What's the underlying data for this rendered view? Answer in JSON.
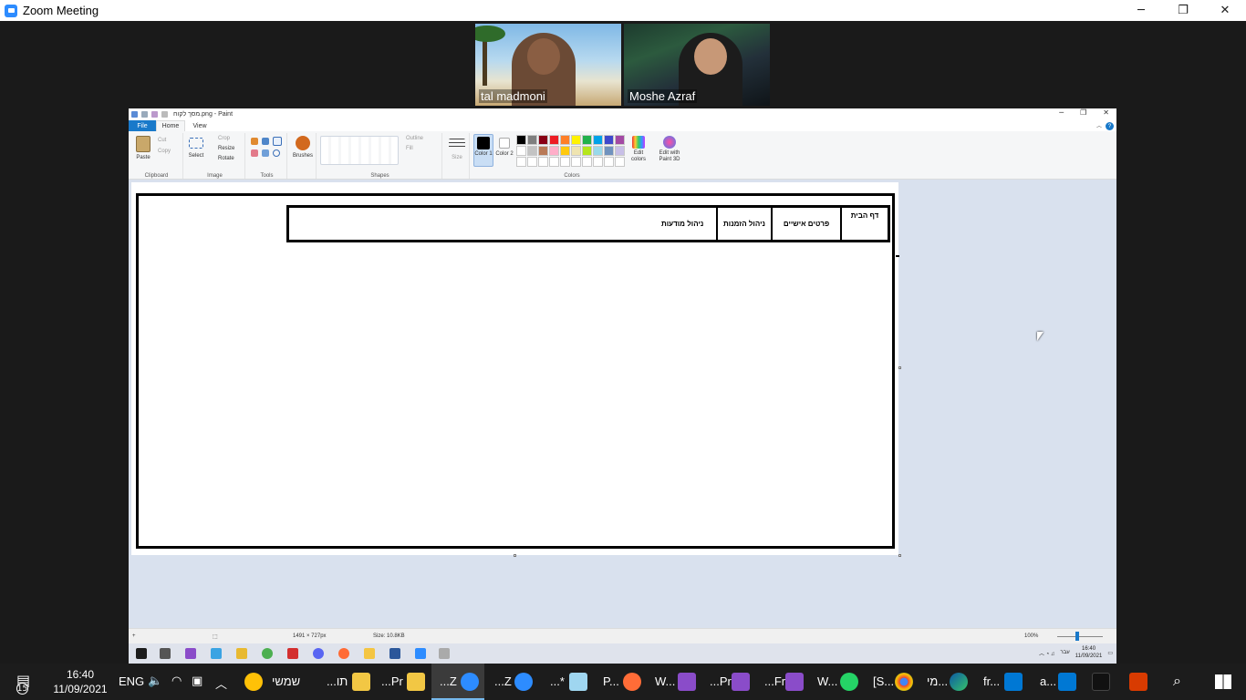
{
  "zoom": {
    "title": "Zoom Meeting",
    "controls": {
      "minimize": "─",
      "restore": "❐",
      "close": "✕"
    },
    "participants": [
      {
        "name": "tal madmoni"
      },
      {
        "name": "Moshe Azraf"
      }
    ]
  },
  "paint": {
    "title": "מסך לקוח.png - Paint",
    "tabs": {
      "file": "File",
      "home": "Home",
      "view": "View"
    },
    "clipboard": {
      "paste": "Paste",
      "cut": "Cut",
      "copy": "Copy",
      "label": "Clipboard"
    },
    "image": {
      "select": "Select",
      "crop": "Crop",
      "resize": "Resize",
      "rotate": "Rotate",
      "label": "Image"
    },
    "tools": {
      "label": "Tools"
    },
    "brushes": {
      "label": "Brushes"
    },
    "shapes": {
      "outline": "Outline",
      "fill": "Fill",
      "label": "Shapes"
    },
    "size": {
      "label": "Size"
    },
    "colors": {
      "color1": "Color 1",
      "color2": "Color 2",
      "edit": "Edit colors",
      "paint3d": "Edit with Paint 3D",
      "label": "Colors"
    },
    "palette": [
      "#000000",
      "#7f7f7f",
      "#880015",
      "#ed1c24",
      "#ff7f27",
      "#fff200",
      "#22b14c",
      "#00a2e8",
      "#3f48cc",
      "#a349a4",
      "#ffffff",
      "#c3c3c3",
      "#b97a57",
      "#ffaec9",
      "#ffc90e",
      "#efe4b0",
      "#b5e61d",
      "#99d9ea",
      "#7092be",
      "#c8bfe7",
      "#ffffff",
      "#ffffff",
      "#ffffff",
      "#ffffff",
      "#ffffff",
      "#ffffff",
      "#ffffff",
      "#ffffff",
      "#ffffff",
      "#ffffff"
    ],
    "canvas_nav": [
      "דף הבית",
      "פרטים אישיים",
      "ניהול הזמנות",
      "ניהול מודעות"
    ],
    "status": {
      "dimensions": "1491 × 727px",
      "size": "Size: 10.8KB",
      "zoom": "100%"
    },
    "remote_tray": {
      "lang": "עבר",
      "time": "16:40",
      "date": "11/09/2021"
    }
  },
  "taskbar": {
    "notifications": "15",
    "clock_time": "16:40",
    "clock_date": "11/09/2021",
    "lang": "ENG",
    "apps": [
      "שמשי",
      "...תו",
      "...Pr",
      "...Z",
      "...Z",
      "...*",
      "P...",
      "W...",
      "...Pr",
      "...Fr",
      "W...",
      "[S...",
      "מי...",
      "fr...",
      "a..."
    ]
  }
}
